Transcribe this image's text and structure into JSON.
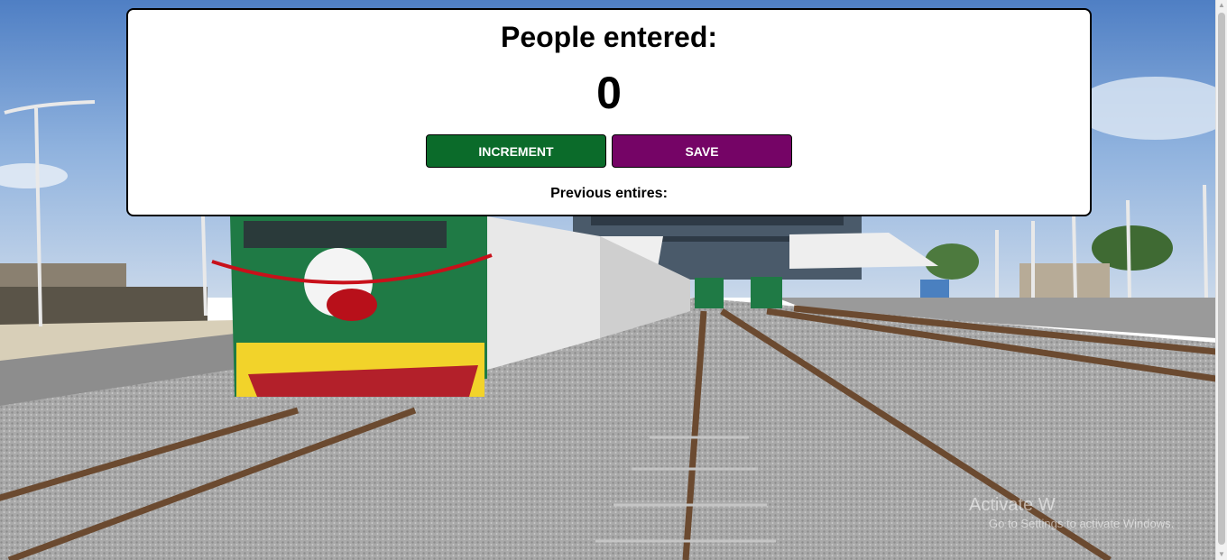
{
  "counter": {
    "heading": "People entered:",
    "count": "0",
    "increment_label": "INCREMENT",
    "save_label": "SAVE",
    "previous_label": "Previous entires:"
  },
  "colors": {
    "increment_button": "#0b6b2a",
    "save_button": "#750466",
    "card_background": "#ffffff",
    "card_border": "#000000"
  },
  "watermark": {
    "title": "Activate W",
    "subtitle": "Go to Settings to activate Windows."
  },
  "background": {
    "description_icon": "railway-station-photo"
  }
}
